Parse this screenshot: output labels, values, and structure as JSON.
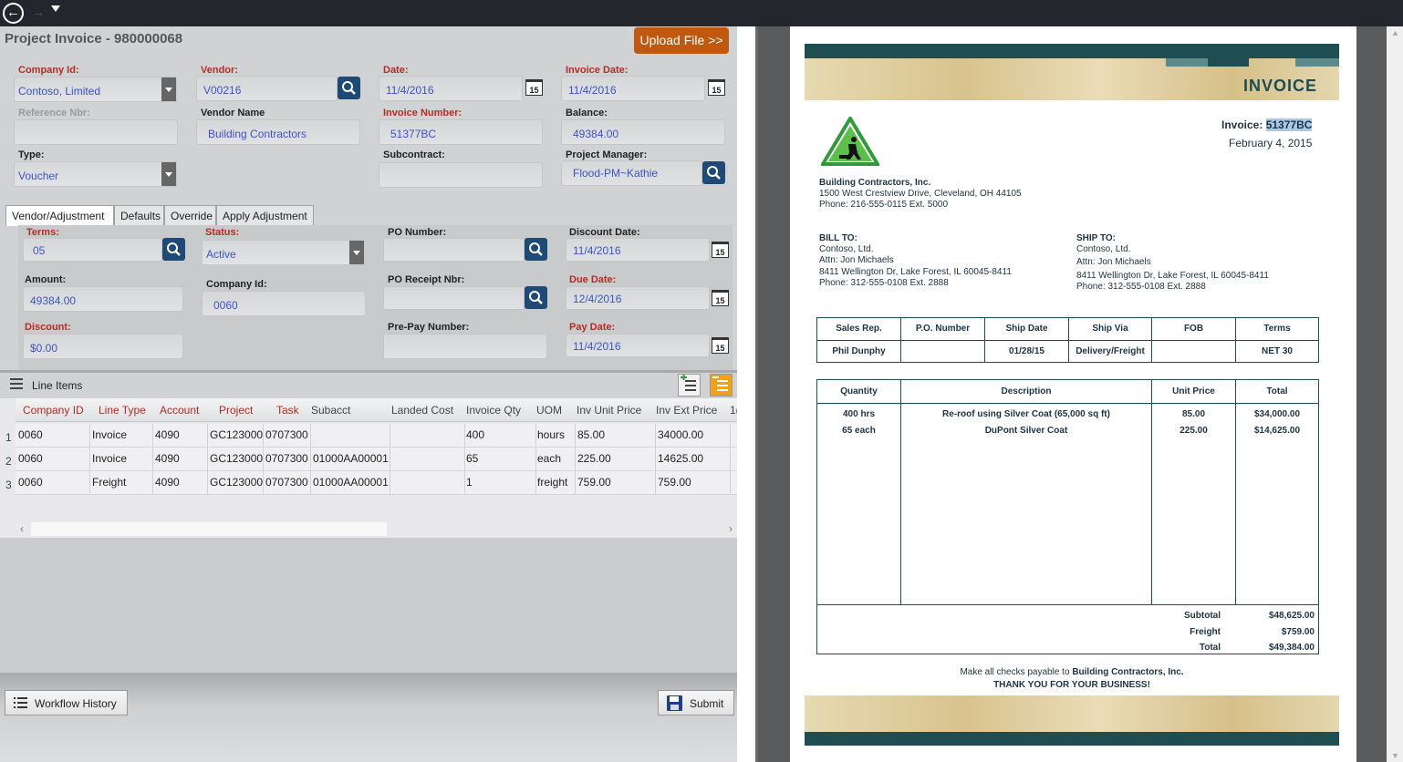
{
  "form": {
    "title": "Project Invoice - 980000068",
    "upload_label": "Upload File >>",
    "company_id": {
      "label": "Company Id:",
      "value": "Contoso, Limited"
    },
    "vendor": {
      "label": "Vendor:",
      "value": "V00216"
    },
    "date": {
      "label": "Date:",
      "value": "11/4/2016"
    },
    "invoice_date": {
      "label": "Invoice Date:",
      "value": "11/4/2016"
    },
    "reference_nbr": {
      "label": "Reference Nbr:",
      "value": ""
    },
    "vendor_name": {
      "label": "Vendor Name",
      "value": "Building Contractors"
    },
    "invoice_number": {
      "label": "Invoice Number:",
      "value": "51377BC"
    },
    "balance": {
      "label": "Balance:",
      "value": "49384.00"
    },
    "type": {
      "label": "Type:",
      "value": "Voucher"
    },
    "subcontract": {
      "label": "Subcontract:",
      "value": ""
    },
    "project_manager": {
      "label": "Project Manager:",
      "value": "Flood-PM~Kathie"
    },
    "calendar_day": "15"
  },
  "tabs": [
    "Vendor/Adjustment",
    "Defaults",
    "Override",
    "Apply Adjustment"
  ],
  "vendor_tab": {
    "terms": {
      "label": "Terms:",
      "value": "05"
    },
    "status": {
      "label": "Status:",
      "value": "Active"
    },
    "po_number": {
      "label": "PO Number:",
      "value": ""
    },
    "discount_date": {
      "label": "Discount Date:",
      "value": "11/4/2016"
    },
    "amount": {
      "label": "Amount:",
      "value": "49384.00"
    },
    "company_id": {
      "label": "Company Id:",
      "value": "0060"
    },
    "po_receipt_nbr": {
      "label": "PO Receipt Nbr:",
      "value": ""
    },
    "due_date": {
      "label": "Due Date:",
      "value": "12/4/2016"
    },
    "discount": {
      "label": "Discount:",
      "value": "$0.00"
    },
    "prepay_number": {
      "label": "Pre-Pay Number:",
      "value": ""
    },
    "pay_date": {
      "label": "Pay Date:",
      "value": "11/4/2016"
    }
  },
  "line_items": {
    "title": "Line Items",
    "columns": [
      "Company ID",
      "Line Type",
      "Account",
      "Project",
      "Task",
      "Subacct",
      "Landed Cost",
      "Invoice Qty",
      "UOM",
      "Inv Unit Price",
      "Inv Ext Price",
      "1("
    ],
    "rows": [
      {
        "n": "1",
        "cells": [
          "0060",
          "Invoice",
          "4090",
          "GC123000",
          "0707300",
          "",
          "",
          "400",
          "hours",
          "85.00",
          "34000.00"
        ]
      },
      {
        "n": "2",
        "cells": [
          "0060",
          "Invoice",
          "4090",
          "GC123000",
          "0707300",
          "01000AA00001",
          "",
          "65",
          "each",
          "225.00",
          "14625.00"
        ]
      },
      {
        "n": "3",
        "cells": [
          "0060",
          "Freight",
          "4090",
          "GC123000",
          "0707300",
          "01000AA00001",
          "",
          "1",
          "freight",
          "759.00",
          "759.00"
        ]
      }
    ]
  },
  "footer": {
    "workflow_label": "Workflow History",
    "submit_label": "Submit"
  },
  "invoice_doc": {
    "heading": "INVOICE",
    "invoice_label": "Invoice:",
    "invoice_no": "51377BC",
    "date": "February 4, 2015",
    "company": "Building Contractors, Inc.",
    "address": "1500 West Crestview Drive, Cleveland, OH 44105",
    "phone": "Phone: 216-555-0115 Ext. 5000",
    "bill_to": [
      "BILL TO:",
      "Contoso, Ltd.",
      "Attn: Jon Michaels",
      "8411 Wellington Dr, Lake Forest, IL 60045-8411",
      "Phone: 312-555-0108 Ext. 2888"
    ],
    "ship_to": [
      "SHIP TO:",
      "Contoso, Ltd.",
      "Attn: Jon Michaels",
      "8411 Wellington Dr, Lake Forest, IL 60045-8411",
      "Phone: 312-555-0108 Ext. 2888"
    ],
    "info_headers": [
      "Sales Rep.",
      "P.O. Number",
      "Ship Date",
      "Ship Via",
      "FOB",
      "Terms"
    ],
    "info_values": [
      "Phil Dunphy",
      "",
      "01/28/15",
      "Delivery/Freight",
      "",
      "NET 30"
    ],
    "item_headers": [
      "Quantity",
      "Description",
      "Unit Price",
      "Total"
    ],
    "items": [
      {
        "qty": "400 hrs",
        "desc": "Re-roof using Silver Coat (65,000 sq ft)",
        "price": "85.00",
        "total": "$34,000.00"
      },
      {
        "qty": "65 each",
        "desc": "DuPont Silver Coat",
        "price": "225.00",
        "total": "$14,625.00"
      }
    ],
    "subtotal_label": "Subtotal",
    "subtotal": "$48,625.00",
    "freight_label": "Freight",
    "freight": "$759.00",
    "total_label": "Total",
    "total": "$49,384.00",
    "payable_prefix": "Make all checks payable to",
    "payable_to": "Building Contractors, Inc.",
    "thanks": "THANK YOU FOR YOUR BUSINESS!"
  },
  "colors": {
    "accent": "#c0580f",
    "required_label": "#b52c23",
    "value_text": "#3a54c8",
    "doc_teal": "#1e4d52",
    "search_button": "#1f4a75"
  }
}
